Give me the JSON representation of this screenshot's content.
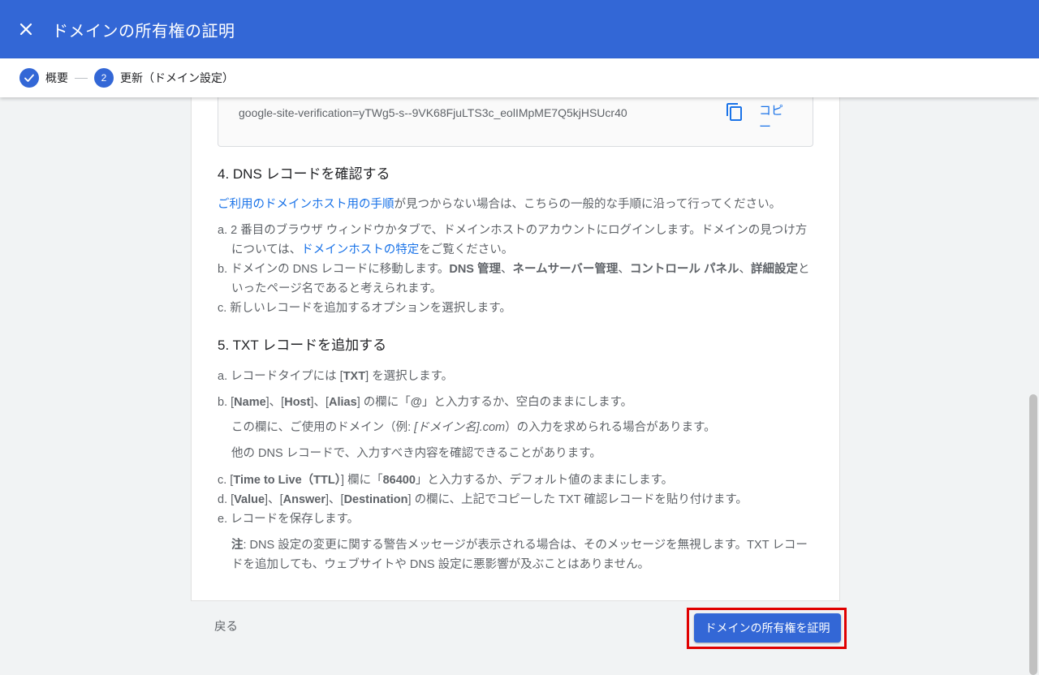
{
  "header": {
    "title": "ドメインの所有権の証明"
  },
  "steps": [
    {
      "label": "概要"
    },
    {
      "number": "2",
      "label": "更新（ドメイン設定）"
    }
  ],
  "code_box": {
    "value": "google-site-verification=yTWg5-s--9VK68FjuLTS3c_eolIMpME7Q5kjHSUcr40",
    "copy_label": "コピー"
  },
  "section4": {
    "heading": "4. DNS レコードを確認する",
    "intro_link": "ご利用のドメインホスト用の手順",
    "intro_text": "が見つからない場合は、こちらの一般的な手順に沿って行ってください。",
    "a_text1": "a. 2 番目のブラウザ ウィンドウかタブで、ドメインホストのアカウントにログインします。ドメインの見つけ方については、",
    "a_link": "ドメインホストの特定",
    "a_text2": "をご覧ください。",
    "b_text1": "b. ドメインの DNS レコードに移動します。",
    "b_bold1": "DNS 管理",
    "b_sep1": "、",
    "b_bold2": "ネームサーバー管理",
    "b_sep2": "、",
    "b_bold3": "コントロール パネル",
    "b_sep3": "、",
    "b_bold4": "詳細設定",
    "b_text2": "といったページ名であると考えられます。",
    "c_text": "c. 新しいレコードを追加するオプションを選択します。"
  },
  "section5": {
    "heading": "5. TXT レコードを追加する",
    "a_text1": "a. レコードタイプには [",
    "a_bold": "TXT",
    "a_text2": "] を選択します。",
    "b_text1": "b. [",
    "b_bold1": "Name",
    "b_text2": "]、[",
    "b_bold2": "Host",
    "b_text3": "]、[",
    "b_bold3": "Alias",
    "b_text4": "] の欄に「",
    "b_bold4": "@",
    "b_text5": "」と入力するか、空白のままにします。",
    "b_note1_text1": "この欄に、ご使用のドメイン（例: ",
    "b_note1_italic": "[ドメイン名].com",
    "b_note1_text2": "）の入力を求められる場合があります。",
    "b_note2": "他の DNS レコードで、入力すべき内容を確認できることがあります。",
    "c_text1": "c. [",
    "c_bold1": "Time to Live（TTL）",
    "c_text2": "] 欄に「",
    "c_bold2": "86400",
    "c_text3": "」と入力するか、デフォルト値のままにします。",
    "d_text1": "d. [",
    "d_bold1": "Value",
    "d_text2": "]、[",
    "d_bold2": "Answer",
    "d_text3": "]、[",
    "d_bold3": "Destination",
    "d_text4": "] の欄に、上記でコピーした TXT 確認レコードを貼り付けます。",
    "e_text": "e. レコードを保存します。",
    "note_bold": "注",
    "note_text": ": DNS 設定の変更に関する警告メッセージが表示される場合は、そのメッセージを無視します。TXT レコードを追加しても、ウェブサイトや DNS 設定に悪影響が及ぶことはありません。"
  },
  "footer": {
    "back_label": "戻る",
    "verify_label": "ドメインの所有権を証明"
  },
  "colors": {
    "primary": "#3367d6",
    "link": "#1a73e8",
    "highlight": "#e00000"
  }
}
